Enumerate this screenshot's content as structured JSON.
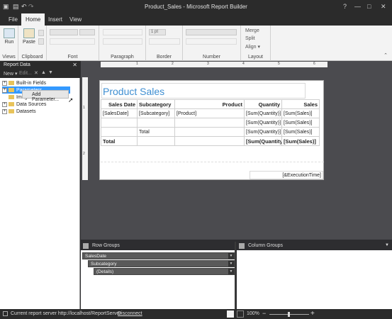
{
  "window": {
    "title": "Product_Sales - Microsoft Report Builder",
    "help": "?",
    "minimize": "—",
    "maximize": "□",
    "close": "✕"
  },
  "ribbon": {
    "tabs": [
      "File",
      "Home",
      "Insert",
      "View"
    ],
    "active_tab": "Home",
    "groups": {
      "views": "Views",
      "clipboard": "Clipboard",
      "font": "Font",
      "paragraph": "Paragraph",
      "border": "Border",
      "number": "Number",
      "layout": "Layout"
    },
    "run_label": "Run",
    "paste_label": "Paste",
    "border_width": "1 pt",
    "merge_label": "Merge",
    "split_label": "Split",
    "align_label": "Align ▾"
  },
  "report_data": {
    "title": "Report Data",
    "close": "✕",
    "new_label": "New ▾",
    "edit_label": "Edit...",
    "tree": [
      {
        "label": "Built-in Fields",
        "expander": "+"
      },
      {
        "label": "Parameters",
        "expander": "+"
      },
      {
        "label": "Images",
        "expander": ""
      },
      {
        "label": "Data Sources",
        "expander": "+"
      },
      {
        "label": "Datasets",
        "expander": "+"
      }
    ],
    "context_menu": "Add Parameter..."
  },
  "report": {
    "title": "Product Sales",
    "headers": [
      "Sales Date",
      "Subcategory",
      "Product",
      "Quantity",
      "Sales"
    ],
    "rows": [
      [
        "[SalesDate]",
        "[Subcategory]",
        "[Product]",
        "[Sum(Quantity)]",
        "[Sum(Sales)]"
      ],
      [
        "",
        "",
        "",
        "[Sum(Quantity)]",
        "[Sum(Sales)]"
      ],
      [
        "",
        "Total",
        "",
        "[Sum(Quantity)]",
        "[Sum(Sales)]"
      ],
      [
        "Total",
        "",
        "",
        "[Sum(Quantity)]",
        "[Sum(Sales)]"
      ]
    ],
    "footer": "[&ExecutionTime]"
  },
  "ruler": {
    "top_marks": [
      "1",
      "2",
      "3",
      "4",
      "5",
      "6"
    ],
    "left_marks": [
      "1",
      "2"
    ]
  },
  "row_groups": {
    "title": "Row Groups",
    "items": [
      "SalesDate",
      "Subcategory",
      "(Details)"
    ]
  },
  "column_groups": {
    "title": "Column Groups"
  },
  "status": {
    "server_text": "Current report server http://localhost/ReportServer",
    "disconnect": "Disconnect",
    "zoom": "100%",
    "zoom_minus": "−",
    "zoom_plus": "+"
  }
}
